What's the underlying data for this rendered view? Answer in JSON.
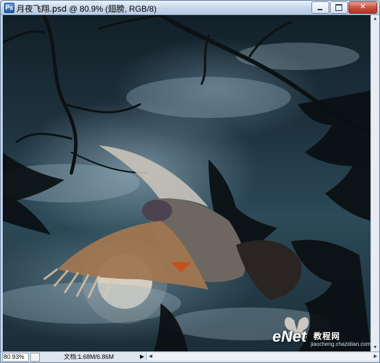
{
  "window": {
    "icon_letter": "Ps",
    "filename": "月夜飞翔.psd",
    "title_suffix": " @ 80.9% (翅膀, RGB/8)"
  },
  "status": {
    "zoom": "80.93%",
    "doc_info": "文档:1.68M/6.86M"
  },
  "watermark": {
    "logo": "eNet",
    "chinese": "教程网",
    "url": "jiaocheng.chazidian.com"
  },
  "icons": [
    "photoshop-doc-icon",
    "minimize-icon",
    "maximize-icon",
    "close-icon",
    "status-menu-icon",
    "scroll-left-icon",
    "scroll-right-icon",
    "scroll-up-icon",
    "scroll-down-icon"
  ],
  "colors": {
    "title_bar": "#c5d6ea",
    "close_button": "#c94a3a",
    "sky": "#1f3440"
  }
}
